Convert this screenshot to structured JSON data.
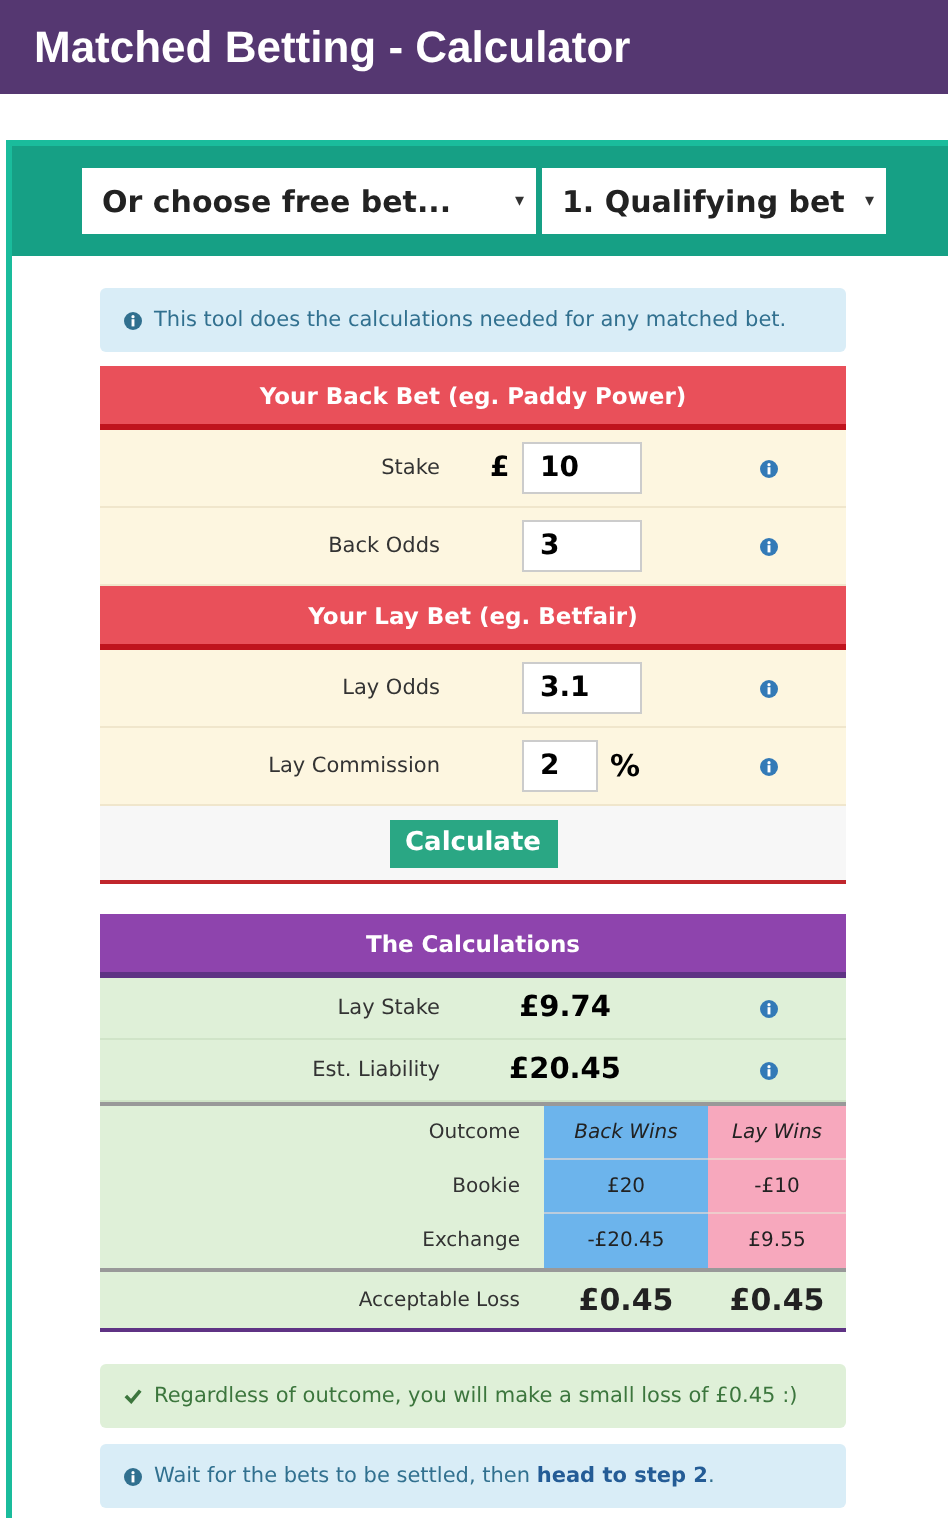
{
  "header": {
    "title": "Matched Betting - Calculator"
  },
  "selects": [
    {
      "value": "Or choose free bet...",
      "arrow": "▾"
    },
    {
      "value": "1. Qualifying bet",
      "arrow": "▾"
    }
  ],
  "intro": {
    "kind": "info",
    "text": "This tool does the calculations needed for any matched bet."
  },
  "sections": [
    {
      "title": "Your Back Bet (eg. Paddy Power)",
      "rows": [
        {
          "label": "Stake",
          "prefix": "£",
          "value": "10"
        },
        {
          "label": "Back Odds",
          "value": "3"
        }
      ]
    },
    {
      "title": "Your Lay Bet (eg. Betfair)",
      "rows": [
        {
          "label": "Lay Odds",
          "value": "3.1"
        },
        {
          "label": "Lay Commission",
          "value": "2",
          "suffix": "%"
        }
      ]
    }
  ],
  "calculate_button": "Calculate",
  "calculations": {
    "title": "The Calculations",
    "summary": [
      {
        "label": "Lay Stake",
        "value": "£9.74"
      },
      {
        "label": "Est. Liability",
        "value": "£20.45"
      }
    ],
    "outcomes": {
      "label": "Outcome",
      "back": "Back Wins",
      "lay": "Lay Wins",
      "rows": [
        {
          "label": "Bookie",
          "back": "£20",
          "lay": "-£10"
        },
        {
          "label": "Exchange",
          "back": "-£20.45",
          "lay": "£9.55"
        }
      ]
    },
    "acceptable_loss": {
      "label": "Acceptable Loss",
      "back": "£0.45",
      "lay": "£0.45"
    }
  },
  "alerts": [
    {
      "kind": "success",
      "text": "Regardless of outcome, you will make a small loss of £0.45 :)"
    },
    {
      "kind": "info",
      "text": "Wait for the bets to be settled, then ",
      "link": "head to step 2",
      "after": "."
    }
  ]
}
